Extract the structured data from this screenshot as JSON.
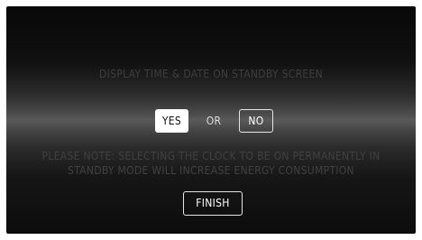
{
  "dialog": {
    "title": "DISPLAY TIME & DATE ON STANDBY SCREEN",
    "yes_label": "YES",
    "or_label": "OR",
    "no_label": "NO",
    "note_line1": "PLEASE NOTE: SELECTING THE CLOCK TO BE ON PERMANENTLY IN",
    "note_line2": "STANDBY MODE WILL INCREASE ENERGY CONSUMPTION",
    "finish_label": "FINISH",
    "selected_option": "YES"
  },
  "colors": {
    "background_dark": "#0c0c0c",
    "background_highlight": "#5a5a5a",
    "selected_button": "#ffffff",
    "muted_text": "#414141"
  }
}
